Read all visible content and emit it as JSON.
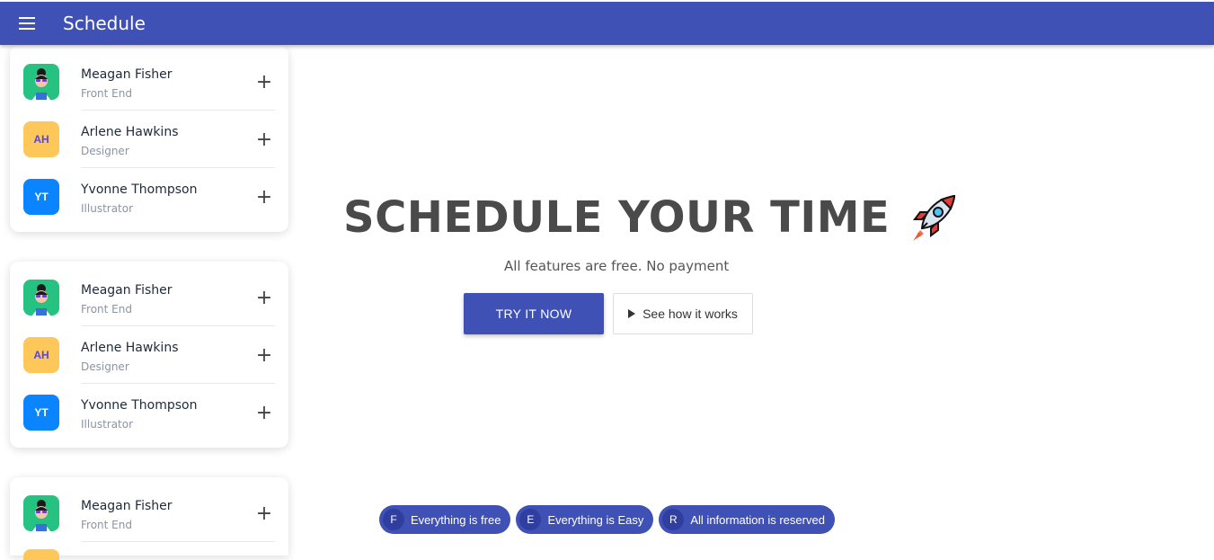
{
  "app": {
    "title": "Schedule"
  },
  "cards": [
    {
      "people": [
        {
          "name": "Meagan Fisher",
          "role": "Front End",
          "avatar": "illustration"
        },
        {
          "name": "Arlene Hawkins",
          "role": "Designer",
          "initials": "AH"
        },
        {
          "name": "Yvonne Thompson",
          "role": "Illustrator",
          "initials": "YT"
        }
      ]
    },
    {
      "people": [
        {
          "name": "Meagan Fisher",
          "role": "Front End",
          "avatar": "illustration"
        },
        {
          "name": "Arlene Hawkins",
          "role": "Designer",
          "initials": "AH"
        },
        {
          "name": "Yvonne Thompson",
          "role": "Illustrator",
          "initials": "YT"
        }
      ]
    },
    {
      "people": [
        {
          "name": "Meagan Fisher",
          "role": "Front End",
          "avatar": "illustration"
        }
      ]
    }
  ],
  "hero": {
    "title": "SCHEDULE YOUR TIME",
    "icon": "rocket-icon",
    "subtitle": "All features are free. No payment",
    "primary_button": "TRY IT NOW",
    "secondary_button": "See how it works"
  },
  "chips": [
    {
      "letter": "F",
      "label": "Everything is free"
    },
    {
      "letter": "E",
      "label": "Everything is Easy"
    },
    {
      "letter": "R",
      "label": "All information is reserved"
    }
  ],
  "colors": {
    "primary": "#3f51b5",
    "avatar_green": "#26c281",
    "avatar_yellow": "#fdc75a",
    "avatar_blue": "#0a84ff"
  }
}
